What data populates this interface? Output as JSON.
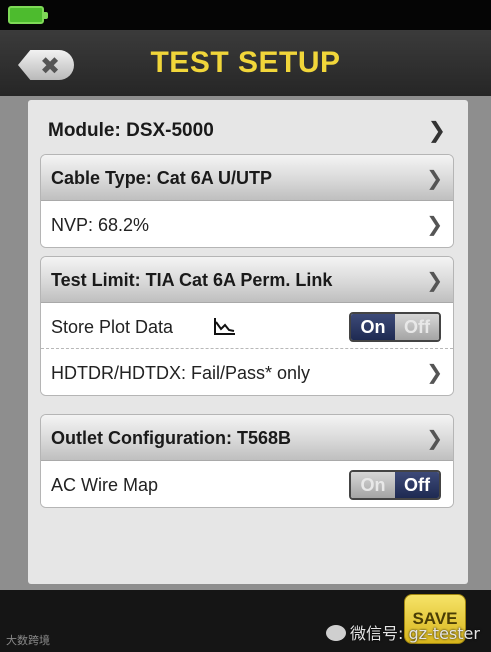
{
  "status_bar": {
    "battery_icon": "battery-full-icon",
    "battery_color": "#4dbb2e"
  },
  "header": {
    "back_icon": "back-close-icon",
    "back_glyph": "✖",
    "title": "TEST SETUP",
    "title_color": "#f1d63a"
  },
  "module": {
    "label": "Module: DSX-5000"
  },
  "cable_card": {
    "header": "Cable Type: Cat 6A U/UTP",
    "nvp": "NVP: 68.2%"
  },
  "limit_card": {
    "header": "Test Limit: TIA Cat 6A Perm. Link",
    "store_plot": {
      "label": "Store Plot Data",
      "icon": "plot-graph-icon",
      "on_label": "On",
      "off_label": "Off",
      "value": "On"
    },
    "hdtdr": "HDTDR/HDTDX: Fail/Pass* only"
  },
  "outlet_card": {
    "header": "Outlet Configuration: T568B",
    "ac_wire_map": {
      "label": "AC Wire Map",
      "on_label": "On",
      "off_label": "Off",
      "value": "Off"
    }
  },
  "footer": {
    "save_label": "SAVE",
    "watermark_left": "大数跨境",
    "watermark_right": "微信号: gz-tester"
  },
  "chevron": "❯"
}
